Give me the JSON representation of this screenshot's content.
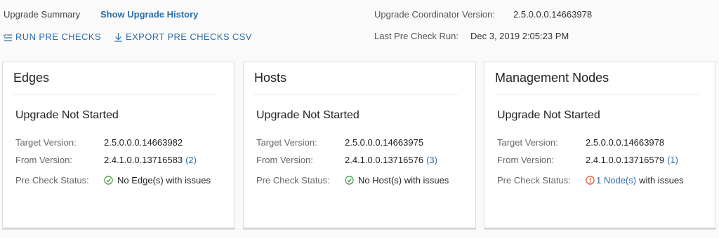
{
  "summary": {
    "title": "Upgrade Summary",
    "history_link": "Show Upgrade History",
    "run_pre_checks": "RUN PRE CHECKS",
    "export_csv": "EXPORT PRE CHECKS CSV",
    "coordinator_label": "Upgrade Coordinator Version:",
    "coordinator_value": "2.5.0.0.0.14663978",
    "last_run_label": "Last Pre Check Run:",
    "last_run_value": "Dec 3, 2019 2:05:23 PM"
  },
  "colors": {
    "link": "#2c6fa8",
    "ok": "#3a9a3a",
    "warning": "#d9532a"
  },
  "cards": [
    {
      "title": "Edges",
      "status": "Upgrade Not Started",
      "target_label": "Target Version:",
      "target_value": "2.5.0.0.0.14663982",
      "from_label": "From Version:",
      "from_value": "2.4.1.0.0.13716583",
      "from_count": "(2)",
      "precheck_label": "Pre Check Status:",
      "precheck_icon": "check-circle-icon",
      "precheck_value": "No Edge(s) with issues"
    },
    {
      "title": "Hosts",
      "status": "Upgrade Not Started",
      "target_label": "Target Version:",
      "target_value": "2.5.0.0.0.14663975",
      "from_label": "From Version:",
      "from_value": "2.4.1.0.0.13716576",
      "from_count": "(3)",
      "precheck_label": "Pre Check Status:",
      "precheck_icon": "check-circle-icon",
      "precheck_value": "No Host(s) with issues"
    },
    {
      "title": "Management Nodes",
      "status": "Upgrade Not Started",
      "target_label": "Target Version:",
      "target_value": "2.5.0.0.0.14663978",
      "from_label": "From Version:",
      "from_value": "2.4.1.0.0.13716579",
      "from_count": "(1)",
      "precheck_label": "Pre Check Status:",
      "precheck_icon": "exclamation-circle-icon",
      "precheck_link": "1 Node(s)",
      "precheck_suffix": "with issues"
    }
  ]
}
